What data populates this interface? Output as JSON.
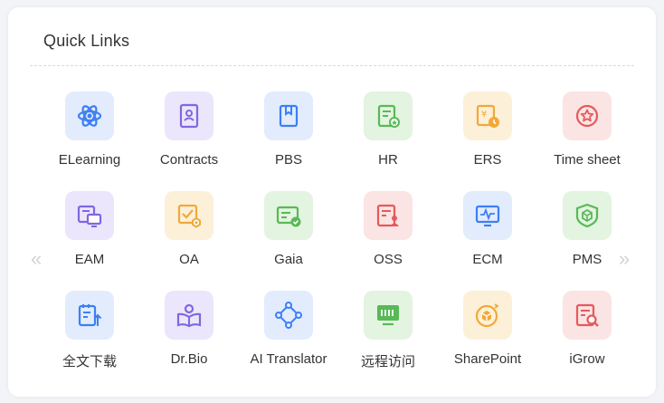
{
  "title": "Quick Links",
  "nav": {
    "prev": "«",
    "next": "»"
  },
  "links": [
    {
      "label": "ELearning",
      "icon": "atom-icon",
      "bg": "#e2ecfd",
      "color": "#3d7ff5"
    },
    {
      "label": "Contracts",
      "icon": "contract-icon",
      "bg": "#ebe6fb",
      "color": "#8067e0"
    },
    {
      "label": "PBS",
      "icon": "book-icon",
      "bg": "#e2ecfd",
      "color": "#3d7ff5"
    },
    {
      "label": "HR",
      "icon": "hr-document-icon",
      "bg": "#e3f4e0",
      "color": "#58b957"
    },
    {
      "label": "ERS",
      "icon": "expense-clock-icon",
      "bg": "#fdf0d9",
      "color": "#f0a938"
    },
    {
      "label": "Time sheet",
      "icon": "star-circle-icon",
      "bg": "#fbe4e4",
      "color": "#e55a5a"
    },
    {
      "label": "EAM",
      "icon": "monitor-icon",
      "bg": "#ebe6fb",
      "color": "#8067e0"
    },
    {
      "label": "OA",
      "icon": "check-box-gear-icon",
      "bg": "#fdf0d9",
      "color": "#f0a938"
    },
    {
      "label": "Gaia",
      "icon": "card-check-icon",
      "bg": "#e3f4e0",
      "color": "#58b957"
    },
    {
      "label": "OSS",
      "icon": "user-document-icon",
      "bg": "#fbe4e4",
      "color": "#e55a5a"
    },
    {
      "label": "ECM",
      "icon": "pulse-monitor-icon",
      "bg": "#e2ecfd",
      "color": "#3d7ff5"
    },
    {
      "label": "PMS",
      "icon": "cube-shield-icon",
      "bg": "#e3f4e0",
      "color": "#58b957"
    },
    {
      "label": "全文下载",
      "icon": "download-document-icon",
      "bg": "#e2ecfd",
      "color": "#3d7ff5"
    },
    {
      "label": "Dr.Bio",
      "icon": "reader-icon",
      "bg": "#ebe6fb",
      "color": "#8067e0"
    },
    {
      "label": "AI Translator",
      "icon": "nodes-icon",
      "bg": "#e2ecfd",
      "color": "#3d7ff5"
    },
    {
      "label": "远程访问",
      "icon": "remote-display-icon",
      "bg": "#e3f4e0",
      "color": "#58b957"
    },
    {
      "label": "SharePoint",
      "icon": "share-cube-icon",
      "bg": "#fdf0d9",
      "color": "#f0a938"
    },
    {
      "label": "iGrow",
      "icon": "search-document-icon",
      "bg": "#fbe4e4",
      "color": "#e55a5a"
    }
  ]
}
